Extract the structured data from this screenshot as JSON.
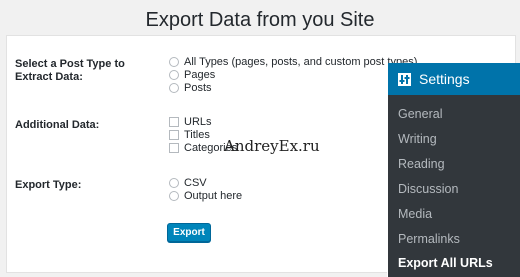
{
  "page": {
    "title": "Export Data from you Site"
  },
  "form": {
    "post_type": {
      "label": "Select a Post Type to Extract Data:",
      "options": [
        "All Types (pages, posts, and custom post types)",
        "Pages",
        "Posts"
      ]
    },
    "additional_data": {
      "label": "Additional Data:",
      "options": [
        "URLs",
        "Titles",
        "Categories"
      ]
    },
    "export_type": {
      "label": "Export Type:",
      "options": [
        "CSV",
        "Output here"
      ]
    },
    "export_button": "Export"
  },
  "watermark": "AndreyEx.ru",
  "settings_menu": {
    "header": "Settings",
    "header_icon": "settings-sliders-icon",
    "items": [
      "General",
      "Writing",
      "Reading",
      "Discussion",
      "Media",
      "Permalinks",
      "Export All URLs"
    ],
    "current": "Export All URLs"
  },
  "colors": {
    "accent": "#0073aa",
    "button": "#0085ba",
    "menu_bg": "#32373c"
  }
}
